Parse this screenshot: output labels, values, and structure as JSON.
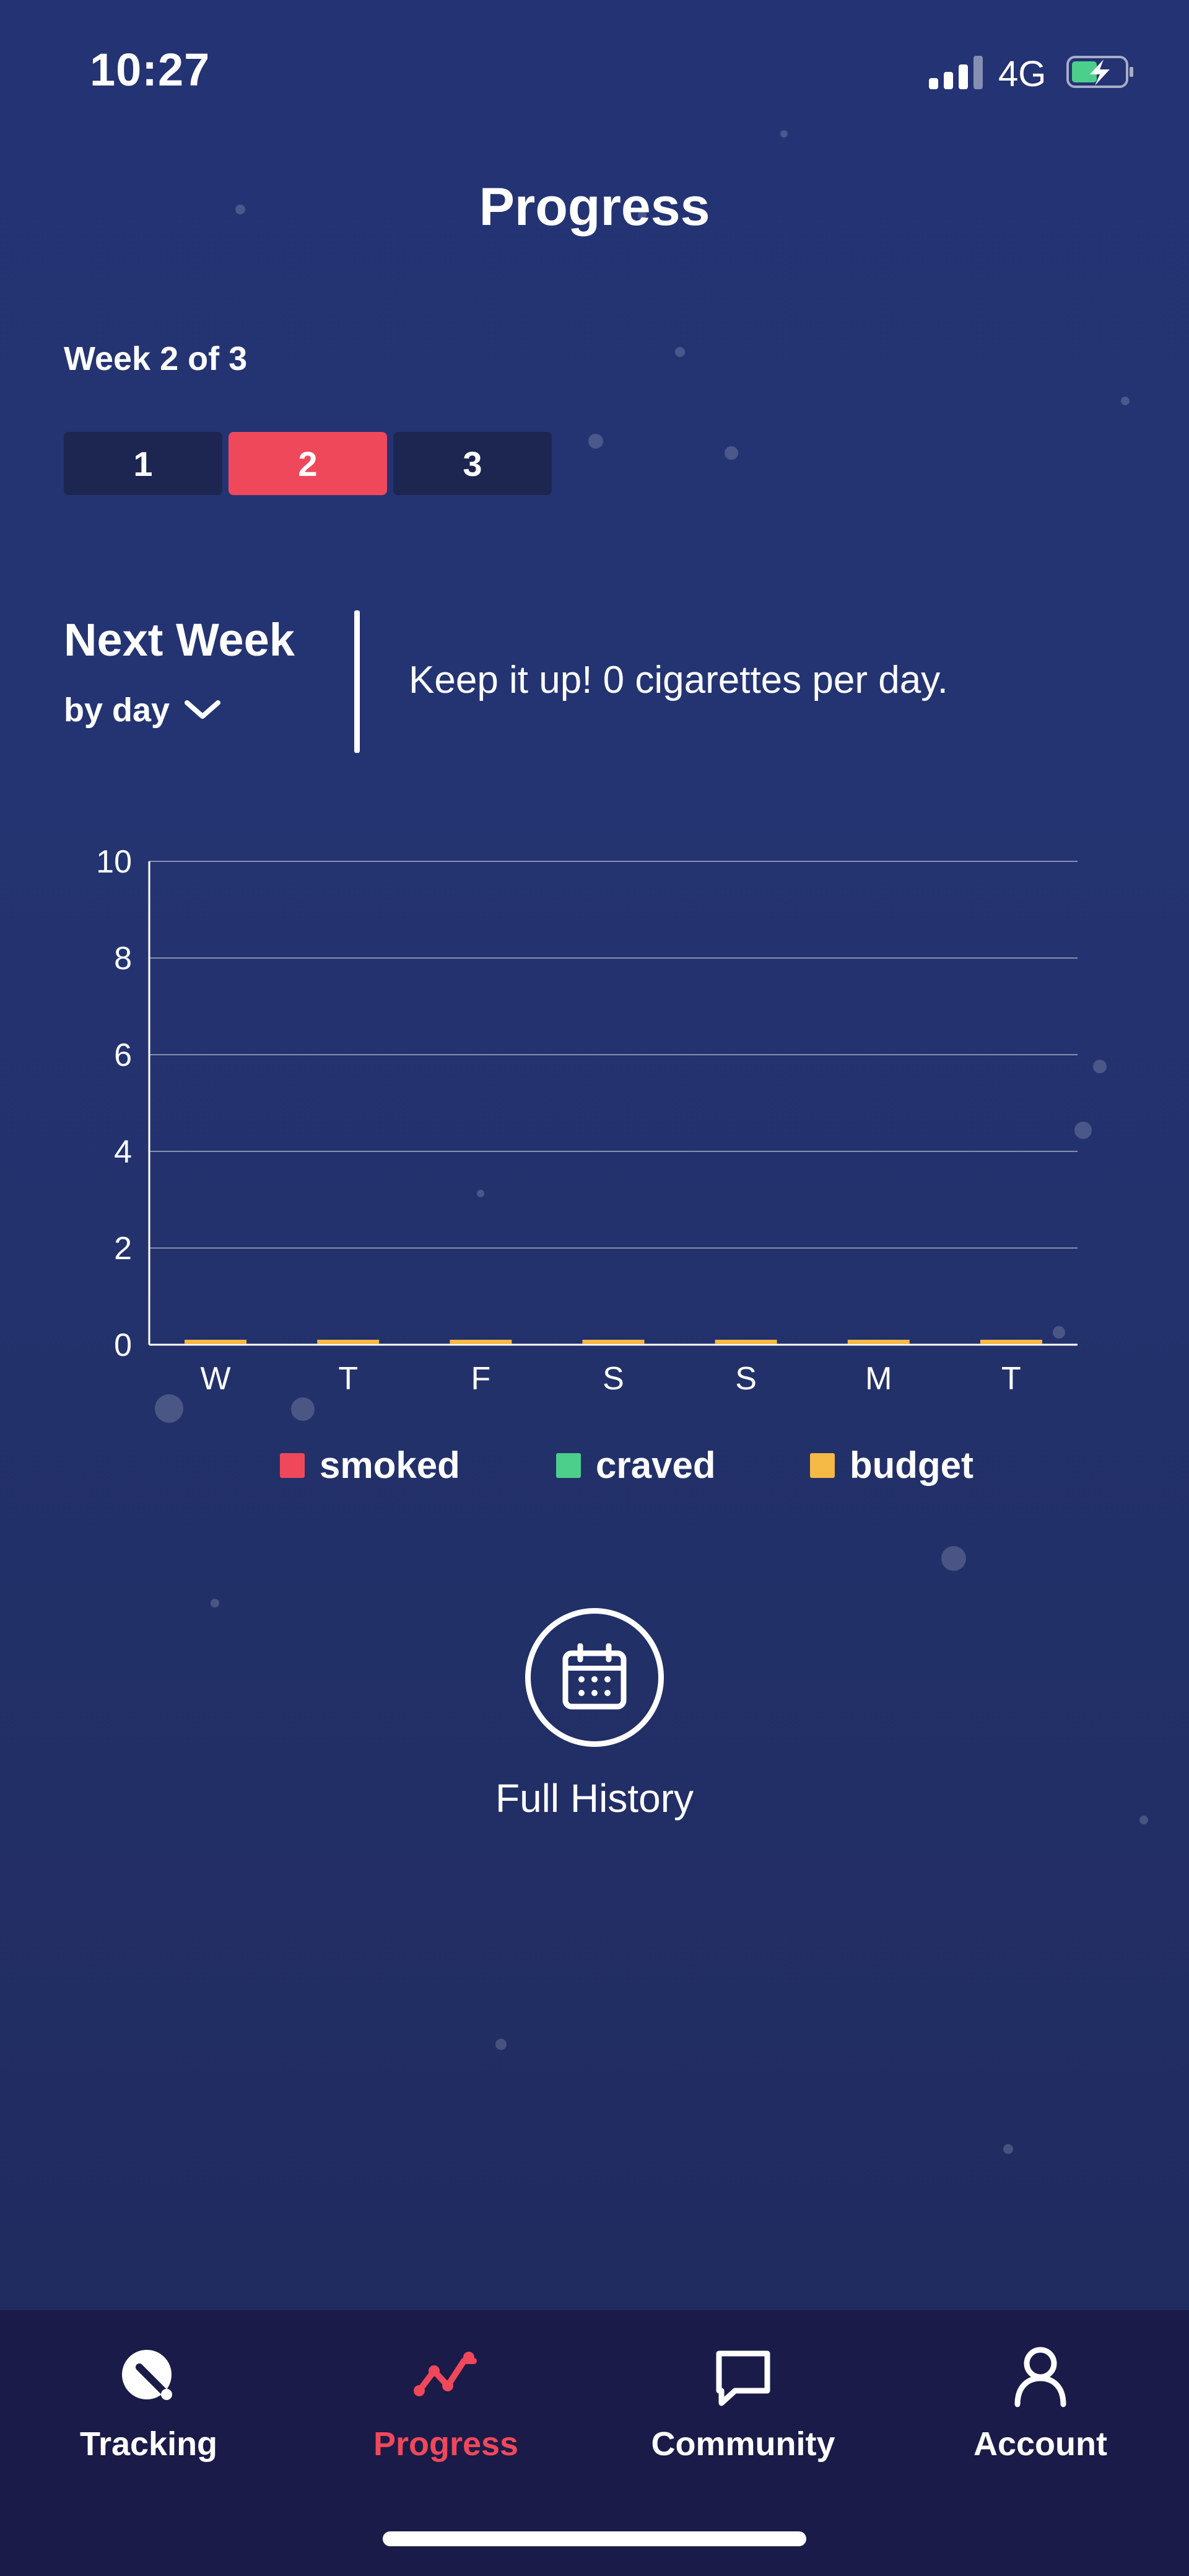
{
  "status_bar": {
    "time": "10:27",
    "network": "4G",
    "icons": [
      "signal-icon",
      "battery-charging-icon"
    ]
  },
  "header": {
    "title": "Progress"
  },
  "week_selector": {
    "label": "Week 2 of 3",
    "tabs": [
      "1",
      "2",
      "3"
    ],
    "active_tab": "2",
    "active_color": "#f0485b"
  },
  "summary": {
    "title": "Next Week",
    "view_mode": "by day",
    "message": "Keep it up! 0 cigarettes per day."
  },
  "chart_data": {
    "type": "bar",
    "categories": [
      "W",
      "T",
      "F",
      "S",
      "S",
      "M",
      "T"
    ],
    "ylim": [
      0,
      10
    ],
    "yticks": [
      "0",
      "2",
      "4",
      "6",
      "8",
      "10"
    ],
    "series": [
      {
        "name": "smoked",
        "color": "#f0485b",
        "values": [
          0,
          0,
          0,
          0,
          0,
          0,
          0
        ]
      },
      {
        "name": "craved",
        "color": "#4ccf8b",
        "values": [
          0,
          0,
          0,
          0,
          0,
          0,
          0
        ]
      },
      {
        "name": "budget",
        "color": "#f5b945",
        "values": [
          0,
          0,
          0,
          0,
          0,
          0,
          0
        ]
      }
    ],
    "grid": true,
    "legend": "bottom"
  },
  "history": {
    "label": "Full History",
    "icon": "calendar-icon"
  },
  "bottom_nav": {
    "items": [
      {
        "label": "Tracking",
        "icon": "tracking-icon"
      },
      {
        "label": "Progress",
        "icon": "progress-icon"
      },
      {
        "label": "Community",
        "icon": "chat-bubble-icon"
      },
      {
        "label": "Account",
        "icon": "user-icon"
      }
    ],
    "active": "Progress"
  }
}
